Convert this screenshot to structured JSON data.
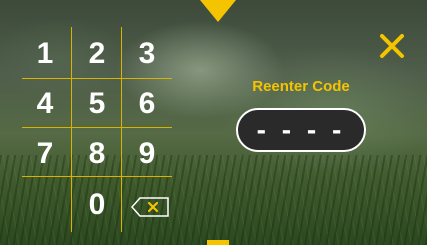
{
  "keypad": {
    "keys": [
      "1",
      "2",
      "3",
      "4",
      "5",
      "6",
      "7",
      "8",
      "9",
      "0"
    ]
  },
  "prompt": "Reenter Code",
  "code_field": {
    "value": "- - - -"
  },
  "icons": {
    "close": "close-x-icon",
    "backspace": "backspace-icon",
    "top": "chevron-down-icon"
  },
  "colors": {
    "accent": "#f5c400",
    "field_bg": "#2a2a2a",
    "text": "#ffffff"
  }
}
